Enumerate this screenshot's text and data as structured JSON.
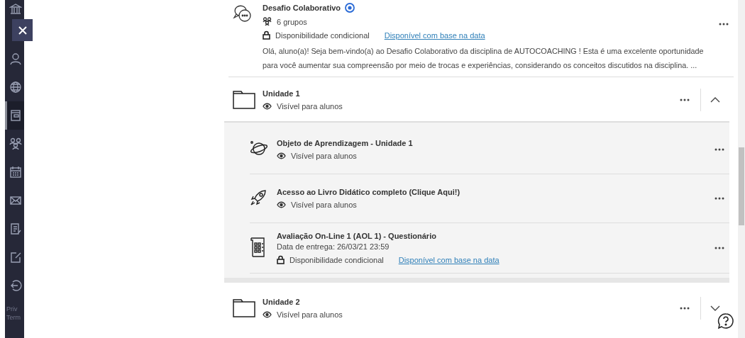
{
  "sidebar": {
    "items": [
      {
        "kind": "institution",
        "selected": false
      },
      {
        "kind": "profile",
        "selected": false
      },
      {
        "kind": "globe",
        "selected": false
      },
      {
        "kind": "courses",
        "selected": true
      },
      {
        "kind": "groups",
        "selected": false
      },
      {
        "kind": "calendar",
        "selected": false
      },
      {
        "kind": "messages",
        "selected": false
      },
      {
        "kind": "grades",
        "selected": false
      },
      {
        "kind": "tools",
        "selected": false
      },
      {
        "kind": "logout",
        "selected": false
      }
    ],
    "footer_links": [
      "Priv",
      "Term"
    ]
  },
  "items": [
    {
      "kind": "discussion",
      "title": "Desafio Colaborativo",
      "groups": "6 grupos",
      "availability": "Disponibilidade condicional",
      "availability_link": "Disponível com base na data",
      "description": "Olá, aluno(a)! Seja bem-vindo(a) ao Desafio Colaborativo da disciplina de AUTOCOACHING ! Esta é uma excelente oportunidade para você aumentar sua compreensão por meio de trocas e experiências, considerando os conceitos discutidos na disciplina. ..."
    },
    {
      "kind": "folder",
      "title": "Unidade 1",
      "visibility": "Visível para alunos",
      "expanded": true,
      "children": [
        {
          "kind": "module",
          "title": "Objeto de Aprendizagem - Unidade 1",
          "visibility": "Visível para alunos"
        },
        {
          "kind": "link",
          "title": "Acesso ao Livro Didático completo (Clique Aqui!)",
          "visibility": "Visível para alunos"
        },
        {
          "kind": "test",
          "title": "Avaliação On-Line 1 (AOL 1) - Questionário",
          "due": "Data de entrega: 26/03/21 23:59",
          "availability": "Disponibilidade condicional",
          "availability_link": "Disponível com base na data"
        }
      ]
    },
    {
      "kind": "folder",
      "title": "Unidade 2",
      "visibility": "Visível para alunos",
      "expanded": false
    }
  ]
}
